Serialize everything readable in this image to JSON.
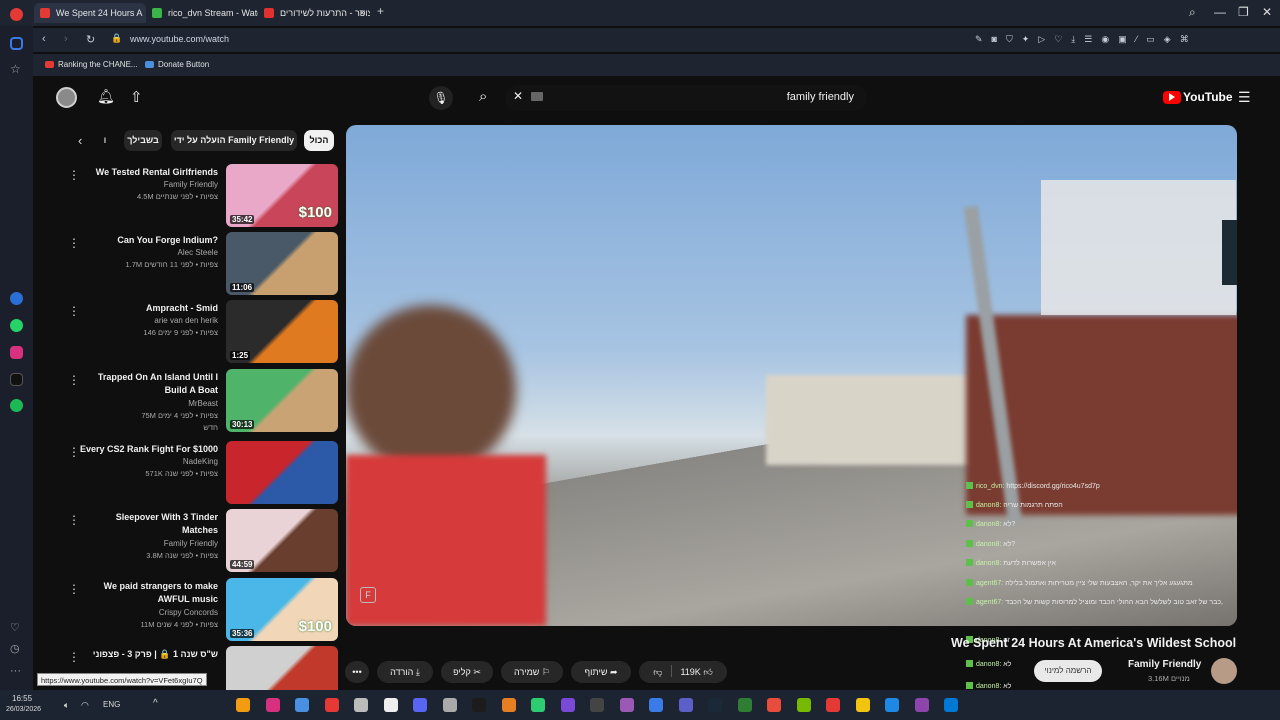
{
  "browser": {
    "tabs": [
      {
        "label": "We Spent 24 Hours A",
        "color": "#e53935",
        "active": true
      },
      {
        "label": "rico_dvn Stream - Watch",
        "color": "#3bb54a",
        "active": false
      },
      {
        "label": "צופר - התרעות לשידורים",
        "color": "#e03030",
        "active": false
      }
    ],
    "new_tab": "+",
    "url": "www.youtube.com/watch",
    "bookmarks": [
      {
        "label": "Ranking the CHANE...",
        "color": "#e53935"
      },
      {
        "label": "Donate Button",
        "color": "#4a8fe0"
      }
    ],
    "status_url": "https://www.youtube.com/watch?v=VFet6xgIu7Q"
  },
  "youtube": {
    "logo_text": "YouTube",
    "search_query": "family friendly",
    "chips": [
      {
        "label": "הכול",
        "selected": true
      },
      {
        "label": "הועלה על ידי Family Friendly",
        "selected": false
      },
      {
        "label": "בשבילך",
        "selected": false
      },
      {
        "label": "ו",
        "selected": false
      }
    ],
    "recommendations": [
      {
        "title1": "We Tested Rental Girlfriends",
        "title2": "",
        "channel": "Family Friendly",
        "meta": "4.5M צפיות • לפני שנתיים",
        "duration": "35:42",
        "thumb_a": "#e9a8c8",
        "thumb_b": "#c9455a",
        "badge": "$100"
      },
      {
        "title1": "Can You Forge Indium?",
        "title2": "",
        "channel": "Alec Steele",
        "meta": "1.7M צפיות • לפני 11 חודשים",
        "duration": "11:06",
        "thumb_a": "#4a5968",
        "thumb_b": "#c8a070",
        "badge": ""
      },
      {
        "title1": "Ampracht - Smid",
        "title2": "",
        "channel": "arie van den herik",
        "meta": "146 צפיות • לפני 9 ימים",
        "duration": "1:25",
        "thumb_a": "#2b2b2b",
        "thumb_b": "#e07a20",
        "badge": ""
      },
      {
        "title1": "Trapped On An Island Until I",
        "title2": "Build A Boat",
        "channel": "MrBeast",
        "meta": "75M צפיות • לפני 4 ימים",
        "tag": "חדש",
        "duration": "30:13",
        "thumb_a": "#4fb36a",
        "thumb_b": "#c9a374",
        "badge": ""
      },
      {
        "title1": "Every CS2 Rank Fight For $1000",
        "title2": "",
        "channel": "NadeKing",
        "meta": "571K צפיות • לפני שנה",
        "duration": "",
        "thumb_a": "#c9252c",
        "thumb_b": "#2c5aa8",
        "badge": ""
      },
      {
        "title1": "Sleepover With 3 Tinder",
        "title2": "Matches",
        "channel": "Family Friendly",
        "meta": "3.8M צפיות • לפני שנה",
        "duration": "44:59",
        "thumb_a": "#e9d3d6",
        "thumb_b": "#6a3e2e",
        "badge": ""
      },
      {
        "title1": "We paid strangers to make",
        "title2": "AWFUL music",
        "channel": "Crispy Concords",
        "meta": "11M צפיות • לפני 4 שנים",
        "duration": "35:36",
        "thumb_a": "#4bb7e8",
        "thumb_b": "#f2d6b8",
        "badge": "$100"
      },
      {
        "title1": "ש\"ס שנה 1 🔒 | פרק 3 - פצפוני",
        "title2": "",
        "channel": "",
        "meta": "",
        "duration": "",
        "thumb_a": "#d0d0d0",
        "thumb_b": "#c0392b",
        "badge": ""
      }
    ],
    "video": {
      "title": "We Spent 24 Hours At America's Wildest School",
      "channel": "Family Friendly",
      "subscribers": "3.16M מנויים",
      "subscribe_label": "הרשמה למינוי",
      "likes": "119K",
      "share_label": "שיתוף",
      "save_label": "שמירה",
      "clip_label": "קליפ",
      "download_label": "הורדה",
      "more_label": "•••"
    },
    "chat": [
      {
        "user": "rico_dvn:",
        "msg": "https://discord.gg/rico4u7sd7p"
      },
      {
        "user": "danon8:",
        "msg": "הפתה תרגמות שריה"
      },
      {
        "user": "danon8:",
        "msg": "לא?"
      },
      {
        "user": "danon8:",
        "msg": "לא?"
      },
      {
        "user": "danon8:",
        "msg": "אין אפשרות לדעת"
      },
      {
        "user": "agent67:",
        "msg": "מתגעגע אליך את יקר, האצבעות שלי ציין מטריחות ואתמול בלילה"
      },
      {
        "user": "agent67:",
        "msg": "כבר של זאב טוב לשלשל הבא החולי הכבד ומוציל למרוסות קשות של הכבד,"
      },
      {
        "user": "danon8:",
        "msg": "זה"
      },
      {
        "user": "danon8:",
        "msg": "לא"
      },
      {
        "user": "danon8:",
        "msg": "לא"
      }
    ]
  },
  "taskbar": {
    "time": "16:55",
    "date": "26/03/2026",
    "lang": "ENG"
  }
}
